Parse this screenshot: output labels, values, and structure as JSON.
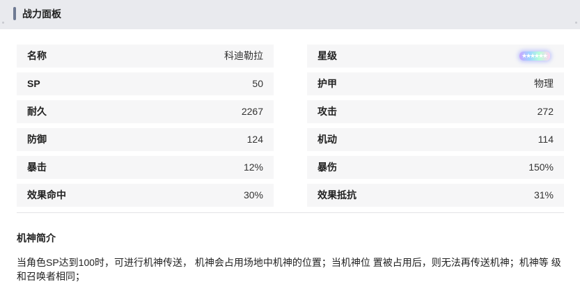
{
  "panel": {
    "title": "战力面板"
  },
  "stats": {
    "left": [
      {
        "label": "名称",
        "value": "科迪勒拉"
      },
      {
        "label": "SP",
        "value": "50"
      },
      {
        "label": "耐久",
        "value": "2267"
      },
      {
        "label": "防御",
        "value": "124"
      },
      {
        "label": "暴击",
        "value": "12%"
      },
      {
        "label": "效果命中",
        "value": "30%"
      }
    ],
    "right": [
      {
        "label": "星级",
        "value": "",
        "stars": 6
      },
      {
        "label": "护甲",
        "value": "物理"
      },
      {
        "label": "攻击",
        "value": "272"
      },
      {
        "label": "机动",
        "value": "114"
      },
      {
        "label": "暴伤",
        "value": "150%"
      },
      {
        "label": "效果抵抗",
        "value": "31%"
      }
    ]
  },
  "intro": {
    "title": "机神简介",
    "text": "当角色SP达到100时，可进行机神传送， 机神会占用场地中机神的位置；当机神位 置被占用后，则无法再传送机神；机神等 级和召唤者相同；"
  },
  "colors": {
    "header_bg": "#e9eaee",
    "accent_bar": "#6f7a93",
    "row_bg": "#f6f6f7"
  },
  "icons": {
    "rarity": "rainbow-star-badge"
  }
}
